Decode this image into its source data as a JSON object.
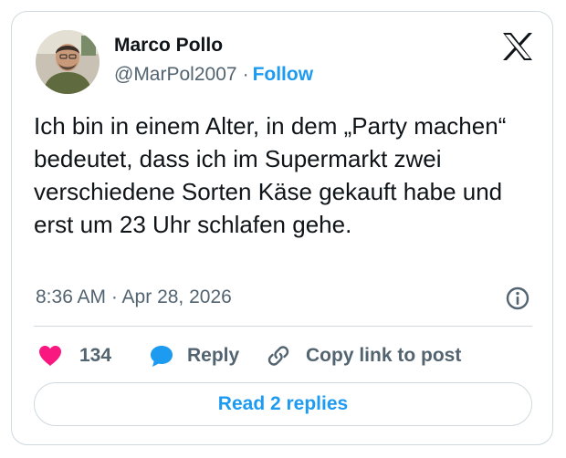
{
  "colors": {
    "accent": "#1d9bf0",
    "like": "#f91880",
    "muted_text": "#536471",
    "main_text": "#0f1419",
    "border": "#cfd9de"
  },
  "author": {
    "name": "Marco Pollo",
    "handle": "@MarPol2007",
    "separator": "·",
    "follow_label": "Follow",
    "avatar_icon": "user-avatar-photo"
  },
  "brand": {
    "logo_icon": "x-logo-icon"
  },
  "tweet": {
    "text": "Ich bin in einem Alter, in dem „Party machen“ bedeutet, dass ich im Supermarkt zwei verschiedene Sorten Käse gekauft habe und erst um 23 Uhr schlafen gehe.",
    "timestamp": "8:36 AM · Apr 28, 2026",
    "info_icon": "info-icon"
  },
  "actions": {
    "like_icon": "heart-icon",
    "like_count": "134",
    "reply_icon": "speech-bubble-icon",
    "reply_label": "Reply",
    "copy_icon": "link-icon",
    "copy_label": "Copy link to post"
  },
  "replies_button": {
    "label": "Read 2 replies"
  }
}
